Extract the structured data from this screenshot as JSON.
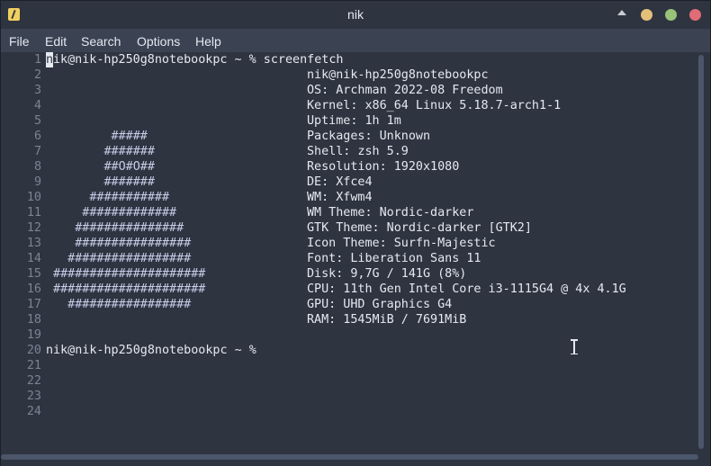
{
  "window": {
    "title": "nik"
  },
  "menu": [
    "File",
    "Edit",
    "Search",
    "Options",
    "Help"
  ],
  "terminal": {
    "line_numbers": [
      "1",
      "2",
      "3",
      "4",
      "5",
      "6",
      "7",
      "8",
      "9",
      "10",
      "11",
      "12",
      "13",
      "14",
      "15",
      "16",
      "17",
      "18",
      "19",
      "20",
      "21",
      "22",
      "23",
      "24"
    ],
    "prompt_first_char": "n",
    "prompt_rest": "ik@nik-hp250g8notebookpc ~ % screenfetch",
    "prompt2": "nik@nik-hp250g8notebookpc ~ %",
    "logo": [
      "",
      "",
      "",
      "",
      "         #####",
      "        #######",
      "        ##O#O##",
      "        #######",
      "      ###########",
      "     #############",
      "    ###############",
      "    ################",
      "   #################",
      " #####################",
      " #####################",
      "   #################"
    ],
    "info": [
      "nik@nik-hp250g8notebookpc",
      "OS: Archman 2022-08 Freedom",
      "Kernel: x86_64 Linux 5.18.7-arch1-1",
      "Uptime: 1h 1m",
      "Packages: Unknown",
      "Shell: zsh 5.9",
      "Resolution: 1920x1080",
      "DE: Xfce4",
      "WM: Xfwm4",
      "WM Theme: Nordic-darker",
      "GTK Theme: Nordic-darker [GTK2]",
      "Icon Theme: Surfn-Majestic",
      "Font: Liberation Sans 11",
      "Disk: 9,7G / 141G (8%)",
      "CPU: 11th Gen Intel Core i3-1115G4 @ 4x 4.1G",
      "GPU: UHD Graphics G4",
      "RAM: 1545MiB / 7691MiB"
    ]
  },
  "colors": {
    "background": "#2e3440",
    "foreground": "#e5e9f0",
    "line_number": "#7b8394",
    "menubar": "#3b4252"
  }
}
